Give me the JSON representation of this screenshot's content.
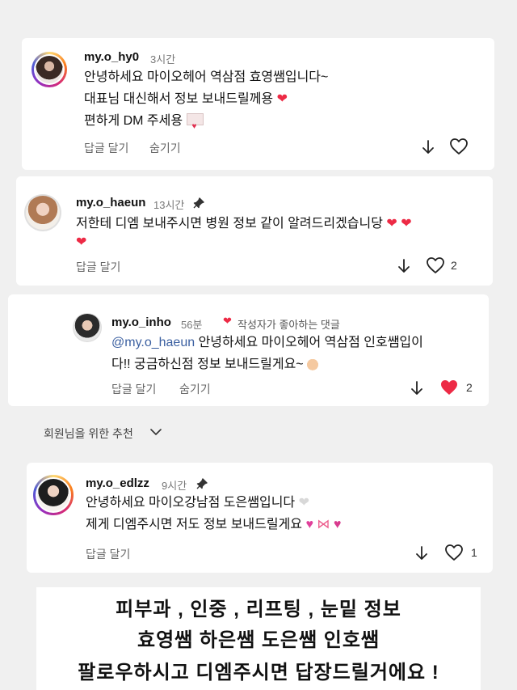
{
  "comments": [
    {
      "username": "my.o_hy0",
      "time": "3시간",
      "lines": [
        "안녕하세요 마이오헤어 역삼점 효영쌤입니다~",
        "대표님 대신해서 정보 보내드릴께용",
        "편하게 DM 주세용"
      ],
      "reply_label": "답글 달기",
      "hide_label": "숨기기",
      "like_count": ""
    },
    {
      "username": "my.o_haeun",
      "time": "13시간",
      "lines": [
        "저한테 디엠 보내주시면 병원 정보 같이 알려드리겠습니당"
      ],
      "reply_label": "답글 달기",
      "like_count": "2"
    },
    {
      "username": "my.o_inho",
      "time": "56분",
      "creator_liked": "작성자가 좋아하는 댓글",
      "mention": "@my.o_haeun",
      "lines": [
        "안녕하세요 마이오헤어 역삼점 인호쌤입이",
        "다!! 궁금하신점 정보 보내드릴게요~"
      ],
      "reply_label": "답글 달기",
      "hide_label": "숨기기",
      "like_count": "2"
    },
    {
      "username": "my.o_edlzz",
      "time": "9시간",
      "lines": [
        "안녕하세요 마이오강남점 도은쌤입니다",
        "제게 디엠주시면 저도 정보 보내드릴게요"
      ],
      "reply_label": "답글 달기",
      "like_count": "1"
    }
  ],
  "recommend": {
    "label": "회원님을 위한 추천"
  },
  "caption": {
    "line1": "피부과 , 인중 , 리프팅 , 눈밑  정보",
    "line2": "효영쌤  하은쌤  도은쌤  인호쌤",
    "line3": "팔로우하시고  디엠주시면  답장드릴거에요 !"
  },
  "icons": [
    "download-arrow-icon",
    "heart-icon",
    "pin-icon",
    "chevron-down-icon"
  ],
  "colors": {
    "liked_heart": "#ed2a45",
    "mention": "#3a5fa0"
  }
}
